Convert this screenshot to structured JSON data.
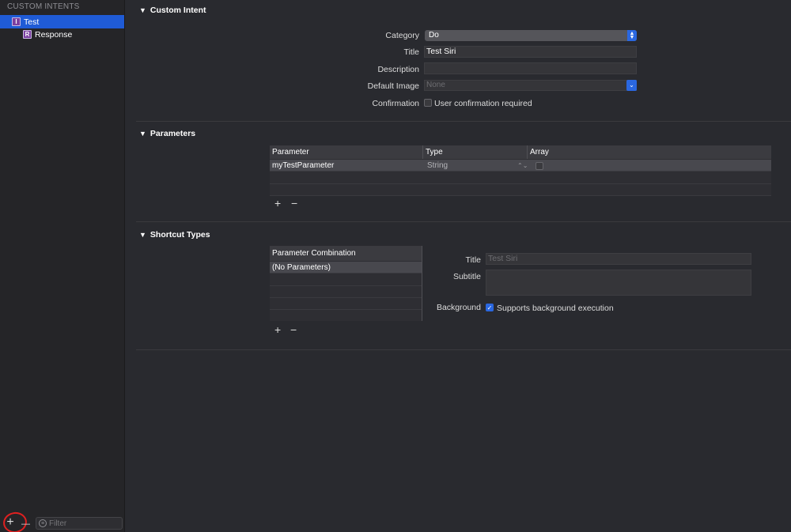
{
  "sidebar": {
    "header": "CUSTOM INTENTS",
    "items": [
      {
        "badge": "I",
        "label": "Test",
        "selected": true
      },
      {
        "badge": "R",
        "label": "Response",
        "selected": false
      }
    ],
    "filter_placeholder": "Filter",
    "add_symbol": "+",
    "remove_symbol": "—"
  },
  "custom_intent": {
    "section_title": "Custom Intent",
    "category_label": "Category",
    "category_value": "Do",
    "title_label": "Title",
    "title_value": "Test Siri",
    "description_label": "Description",
    "description_value": "",
    "default_image_label": "Default Image",
    "default_image_value": "None",
    "confirmation_label": "Confirmation",
    "confirmation_text": "User confirmation required",
    "confirmation_checked": false
  },
  "parameters": {
    "section_title": "Parameters",
    "columns": [
      "Parameter",
      "Type",
      "Array"
    ],
    "rows": [
      {
        "name": "myTestParameter",
        "type": "String",
        "array": false
      }
    ]
  },
  "shortcut_types": {
    "section_title": "Shortcut Types",
    "list_header": "Parameter Combination",
    "items": [
      "(No Parameters)"
    ],
    "title_label": "Title",
    "title_placeholder": "Test Siri",
    "subtitle_label": "Subtitle",
    "subtitle_value": "",
    "background_label": "Background",
    "background_text": "Supports background execution",
    "background_checked": true
  },
  "colors": {
    "accent": "#2a67e0",
    "selection": "#1f5bd6",
    "annotation": "#e02020"
  }
}
